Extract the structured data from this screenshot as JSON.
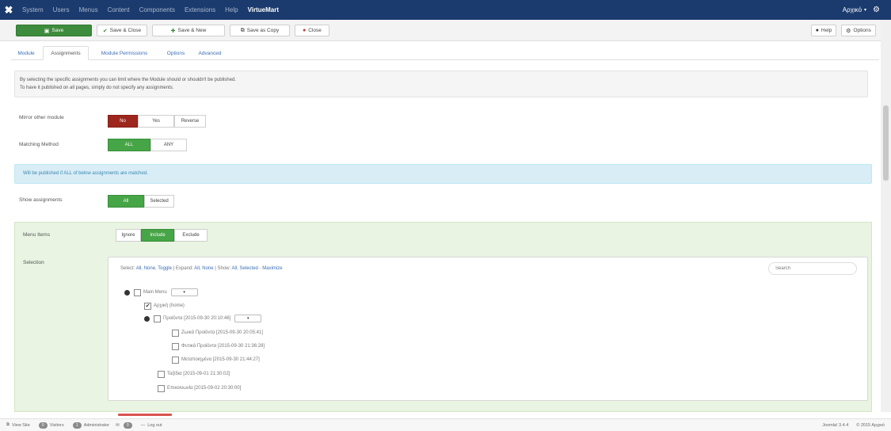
{
  "topbar": {
    "menu": [
      "System",
      "Users",
      "Menus",
      "Content",
      "Components",
      "Extensions",
      "Help"
    ],
    "site_name": "VirtueMart",
    "user_label": "Αρχικό"
  },
  "toolbar": {
    "save": "Save",
    "save_close": "Save & Close",
    "save_new": "Save & New",
    "save_copy": "Save as Copy",
    "close": "Close",
    "help": "Help",
    "options": "Options"
  },
  "tabs": [
    "Module",
    "Assignments",
    "Module Permissions",
    "Options",
    "Advanced"
  ],
  "info": {
    "line1": "By selecting the specific assignments you can limit where the Module should or shouldn't be published.",
    "line2": "To have it published on all pages, simply do not specify any assignments."
  },
  "mirror": {
    "label": "Mirror other module",
    "options": [
      "No",
      "Yes",
      "Reverse"
    ]
  },
  "matching": {
    "label": "Matching Method",
    "options": [
      "ALL",
      "ANY"
    ]
  },
  "alert": "Will be published if ALL of below assignments are matched.",
  "show_assignments": {
    "label": "Show assignments",
    "options": [
      "All",
      "Selected"
    ]
  },
  "menu_items": {
    "label": "Menu Items",
    "options": [
      "Ignore",
      "Include",
      "Exclude"
    ]
  },
  "selection": {
    "label": "Selection",
    "links_prefix_select": "Select:",
    "link_all": "All",
    "link_none": "None",
    "link_toggle": "Toggle",
    "expand_prefix": "| Expand:",
    "link_expand_all": "All",
    "link_expand_none": "None",
    "show_prefix": "| Show:",
    "link_show_all": "All",
    "link_selected": "Selected",
    "link_maximize": "Maximize",
    "search_placeholder": "Search",
    "tree": [
      {
        "text": "Main Menu",
        "checked": false,
        "has_toggle": true,
        "has_dropdown": true
      },
      {
        "text": "Αρχική (home)",
        "checked": true,
        "has_toggle": false,
        "has_dropdown": false
      },
      {
        "text": "Προϊόντα [2015-09-30 20:10:46]",
        "checked": false,
        "has_toggle": true,
        "has_dropdown": true
      },
      {
        "text": "Ζωικά Προϊόντα [2015-09-30 20:05:41]",
        "checked": false,
        "has_toggle": false,
        "has_dropdown": false
      },
      {
        "text": "Φυτικά Προϊόντα [2015-09-30 21:36:28]",
        "checked": false,
        "has_toggle": false,
        "has_dropdown": false
      },
      {
        "text": "Μεταποιημένα [2015-09-30 21:44:27]",
        "checked": false,
        "has_toggle": false,
        "has_dropdown": false
      },
      {
        "text": "Ταξίδια [2015-09-01 21:30:02]",
        "checked": false,
        "has_toggle": false,
        "has_dropdown": false
      },
      {
        "text": "Επικοινωνία [2015-09-02 20:30:00]",
        "checked": false,
        "has_toggle": false,
        "has_dropdown": false
      }
    ]
  },
  "status_bar": {
    "view_site": "View Site",
    "visitors": "Visitors",
    "visitors_count": "0",
    "administrator": "Administrator",
    "administrator_count": "1",
    "messages_count": "0",
    "logout": "Log out",
    "version": "Joomla! 3.4.4",
    "copyright": "© 2015 Αρχικό"
  }
}
